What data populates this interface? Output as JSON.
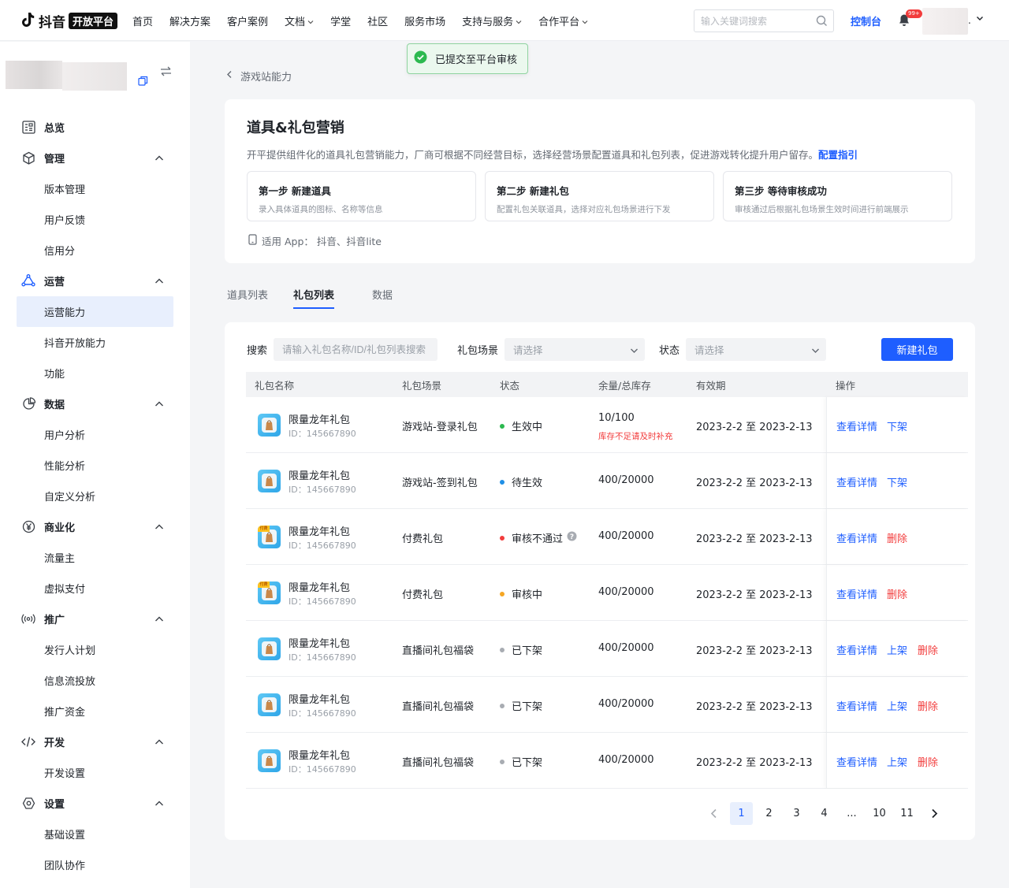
{
  "topnav": {
    "brand_text": "抖音",
    "brand_tag": "开放平台",
    "items": [
      {
        "label": "首页",
        "caret": false
      },
      {
        "label": "解决方案",
        "caret": false
      },
      {
        "label": "客户案例",
        "caret": false
      },
      {
        "label": "文档",
        "caret": true
      },
      {
        "label": "学堂",
        "caret": false
      },
      {
        "label": "社区",
        "caret": false
      },
      {
        "label": "服务市场",
        "caret": false
      },
      {
        "label": "支持与服务",
        "caret": true
      },
      {
        "label": "合作平台",
        "caret": true
      }
    ],
    "search_placeholder": "输入关键词搜索",
    "console_label": "控制台",
    "notification_badge": "99+",
    "user_suffix": "."
  },
  "sidebar": {
    "groups": [
      {
        "key": "overview",
        "label": "总览",
        "icon": "overview-icon",
        "collapsible": false,
        "items": []
      },
      {
        "key": "manage",
        "label": "管理",
        "icon": "cube-icon",
        "collapsible": true,
        "items": [
          "版本管理",
          "用户反馈",
          "信用分"
        ]
      },
      {
        "key": "operate",
        "label": "运营",
        "icon": "operate-icon",
        "collapsible": true,
        "items": [
          "运营能力",
          "抖音开放能力",
          "功能"
        ],
        "active_item": "运营能力"
      },
      {
        "key": "data",
        "label": "数据",
        "icon": "pie-chart-icon",
        "collapsible": true,
        "items": [
          "用户分析",
          "性能分析",
          "自定义分析"
        ]
      },
      {
        "key": "commerce",
        "label": "商业化",
        "icon": "yen-icon",
        "collapsible": true,
        "items": [
          "流量主",
          "虚拟支付"
        ]
      },
      {
        "key": "promote",
        "label": "推广",
        "icon": "broadcast-icon",
        "collapsible": true,
        "items": [
          "发行人计划",
          "信息流投放",
          "推广资金"
        ]
      },
      {
        "key": "dev",
        "label": "开发",
        "icon": "code-icon",
        "collapsible": true,
        "items": [
          "开发设置"
        ]
      },
      {
        "key": "settings",
        "label": "设置",
        "icon": "hexagon-settings-icon",
        "collapsible": true,
        "items": [
          "基础设置",
          "团队协作"
        ]
      }
    ]
  },
  "breadcrumb": {
    "back_label": "游戏站能力"
  },
  "toast": {
    "message": "已提交至平台审核"
  },
  "intro": {
    "title": "道具&礼包营销",
    "description": "开平提供组件化的道具礼包营销能力，厂商可根据不同经营目标，选择经营场景配置道具和礼包列表，促进游戏转化提升用户留存。",
    "guide_link": "配置指引",
    "steps": [
      {
        "title": "第一步 新建道具",
        "desc": "录入具体道具的图标、名称等信息"
      },
      {
        "title": "第二步 新建礼包",
        "desc": "配置礼包关联道具，选择对应礼包场景进行下发"
      },
      {
        "title": "第三步 等待审核成功",
        "desc": "审核通过后根据礼包场景生效时间进行前端展示"
      }
    ],
    "apps_text": "适用 App： 抖音、抖音lite"
  },
  "tabs": [
    {
      "label": "道具列表",
      "active": false
    },
    {
      "label": "礼包列表",
      "active": true
    },
    {
      "label": "数据",
      "active": false
    }
  ],
  "filters": {
    "search_label": "搜索",
    "search_placeholder": "请输入礼包名称/ID/礼包列表搜索",
    "scene_label": "礼包场景",
    "scene_placeholder": "请选择",
    "status_label": "状态",
    "status_placeholder": "请选择",
    "new_button": "新建礼包"
  },
  "table": {
    "headers": [
      "礼包名称",
      "礼包场景",
      "状态",
      "余量/总库存",
      "有效期",
      "操作"
    ],
    "rows": [
      {
        "name": "限量龙年礼包",
        "id": "ID：145667890",
        "paid": false,
        "scene": "游戏站-登录礼包",
        "status": "生效中",
        "status_color": "#2cb94f",
        "stock": "10/100",
        "warning": "库存不足请及时补充",
        "help": false,
        "period": "2023-2-2 至 2023-2-13",
        "ops": [
          {
            "label": "查看详情",
            "type": "link"
          },
          {
            "label": "下架",
            "type": "link"
          }
        ]
      },
      {
        "name": "限量龙年礼包",
        "id": "ID：145667890",
        "paid": false,
        "scene": "游戏站-签到礼包",
        "status": "待生效",
        "status_color": "#1f8fe6",
        "stock": "400/20000",
        "warning": "",
        "help": false,
        "period": "2023-2-2 至 2023-2-13",
        "ops": [
          {
            "label": "查看详情",
            "type": "link"
          },
          {
            "label": "下架",
            "type": "link"
          }
        ]
      },
      {
        "name": "限量龙年礼包",
        "id": "ID：145667890",
        "paid": true,
        "pay_tag": "付费",
        "scene": "付费礼包",
        "status": "审核不通过",
        "status_color": "#f23c3c",
        "stock": "400/20000",
        "warning": "",
        "help": true,
        "period": "2023-2-2 至 2023-2-13",
        "ops": [
          {
            "label": "查看详情",
            "type": "link"
          },
          {
            "label": "删除",
            "type": "danger"
          }
        ]
      },
      {
        "name": "限量龙年礼包",
        "id": "ID：145667890",
        "paid": true,
        "pay_tag": "付费",
        "scene": "付费礼包",
        "status": "审核中",
        "status_color": "#f5a623",
        "stock": "400/20000",
        "warning": "",
        "help": false,
        "period": "2023-2-2 至 2023-2-13",
        "ops": [
          {
            "label": "查看详情",
            "type": "link"
          },
          {
            "label": "删除",
            "type": "danger"
          }
        ]
      },
      {
        "name": "限量龙年礼包",
        "id": "ID：145667890",
        "paid": false,
        "scene": "直播间礼包福袋",
        "status": "已下架",
        "status_color": "#a8acb2",
        "stock": "400/20000",
        "warning": "",
        "help": false,
        "period": "2023-2-2 至 2023-2-13",
        "ops": [
          {
            "label": "查看详情",
            "type": "link"
          },
          {
            "label": "上架",
            "type": "link"
          },
          {
            "label": "删除",
            "type": "danger"
          }
        ]
      },
      {
        "name": "限量龙年礼包",
        "id": "ID：145667890",
        "paid": false,
        "scene": "直播间礼包福袋",
        "status": "已下架",
        "status_color": "#a8acb2",
        "stock": "400/20000",
        "warning": "",
        "help": false,
        "period": "2023-2-2 至 2023-2-13",
        "ops": [
          {
            "label": "查看详情",
            "type": "link"
          },
          {
            "label": "上架",
            "type": "link"
          },
          {
            "label": "删除",
            "type": "danger"
          }
        ]
      },
      {
        "name": "限量龙年礼包",
        "id": "ID：145667890",
        "paid": false,
        "scene": "直播间礼包福袋",
        "status": "已下架",
        "status_color": "#a8acb2",
        "stock": "400/20000",
        "warning": "",
        "help": false,
        "period": "2023-2-2 至 2023-2-13",
        "ops": [
          {
            "label": "查看详情",
            "type": "link"
          },
          {
            "label": "上架",
            "type": "link"
          },
          {
            "label": "删除",
            "type": "danger"
          }
        ]
      }
    ]
  },
  "pagination": {
    "pages": [
      "1",
      "2",
      "3",
      "4",
      "...",
      "10",
      "11"
    ],
    "current": "1"
  },
  "colors": {
    "accent": "#1e5eff",
    "danger": "#f23c3c",
    "success": "#2cb94f"
  }
}
